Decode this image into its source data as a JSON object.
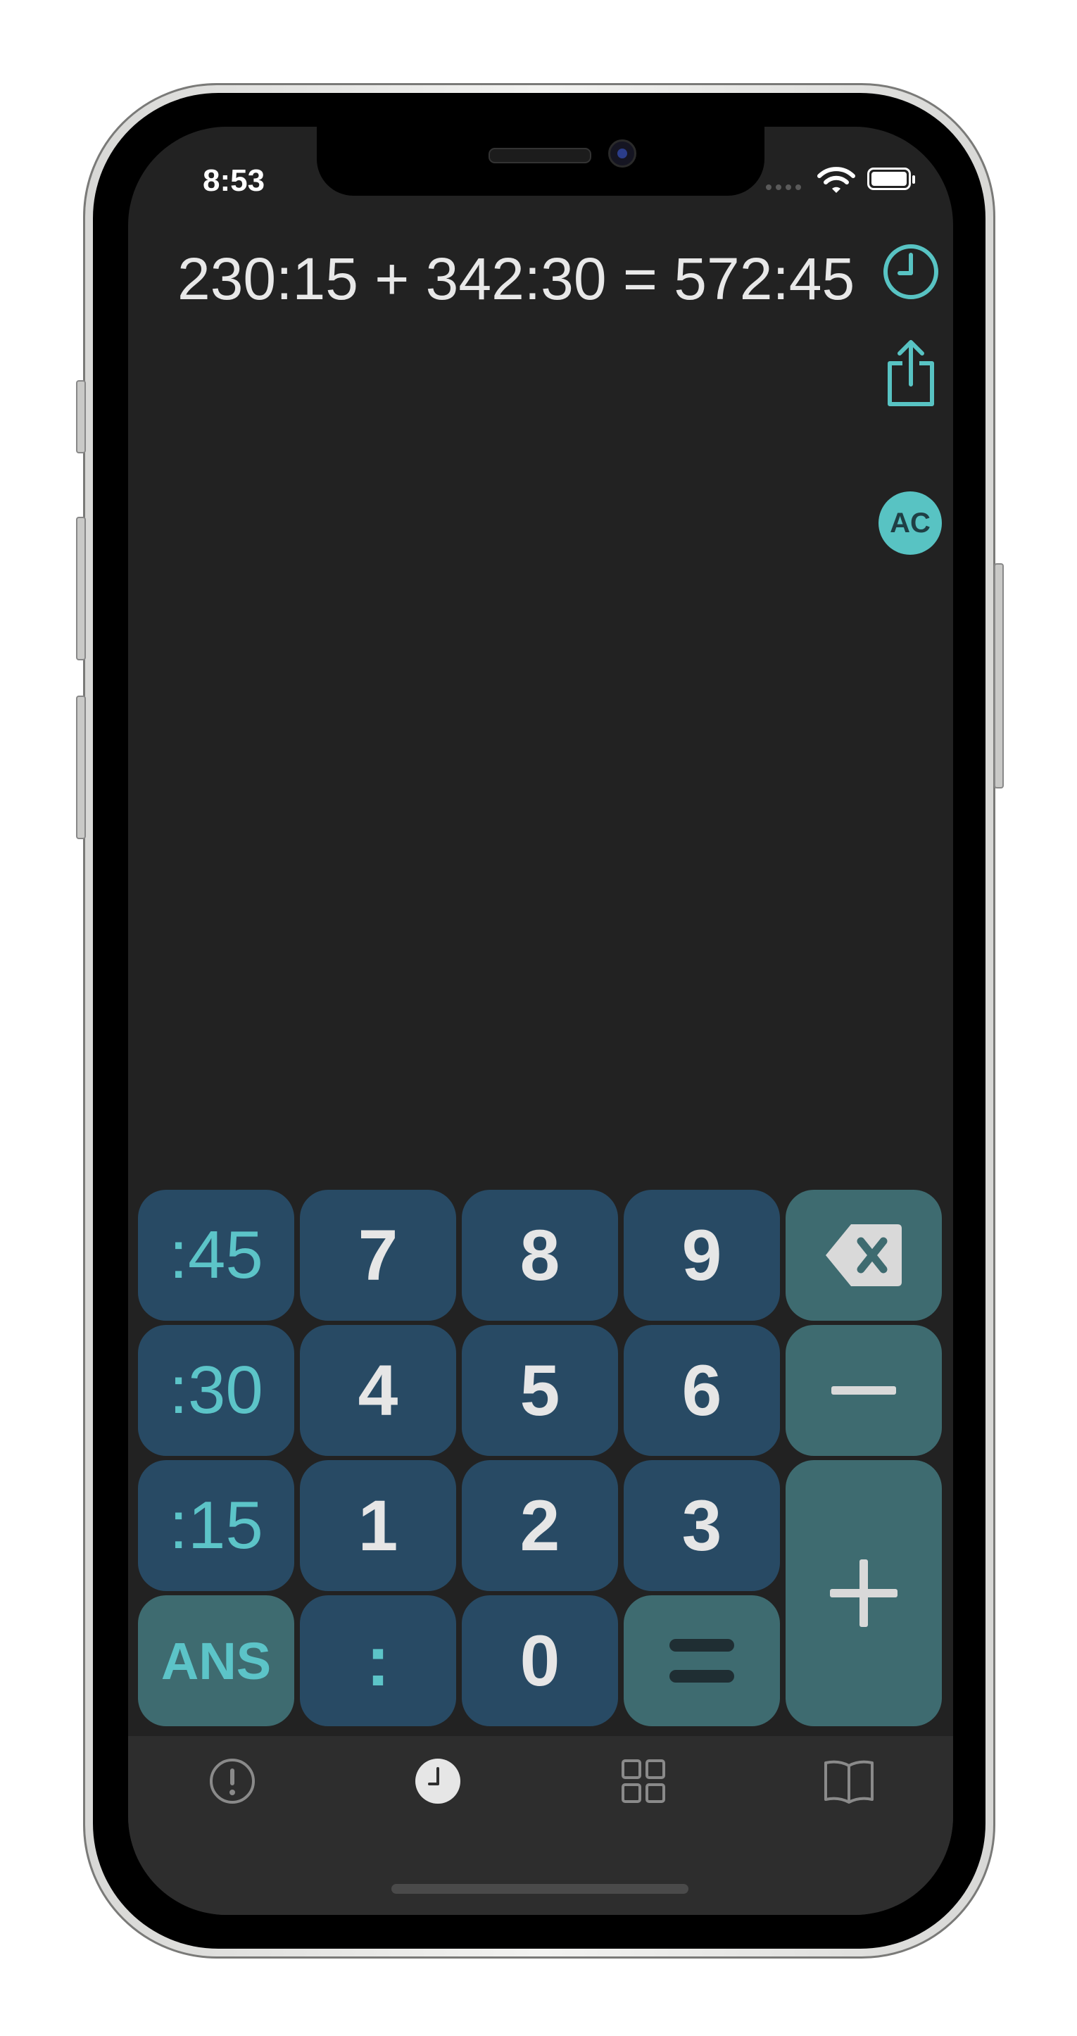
{
  "status_bar": {
    "time": "8:53"
  },
  "display": {
    "expression": "230:15 + 342:30 = 572:45"
  },
  "actions": {
    "history_icon": "clock-icon",
    "share_icon": "share-icon",
    "clear_label": "AC"
  },
  "keypad": {
    "quick_45": ":45",
    "quick_30": ":30",
    "quick_15": ":15",
    "ans": "ANS",
    "digits": {
      "d7": "7",
      "d8": "8",
      "d9": "9",
      "d4": "4",
      "d5": "5",
      "d6": "6",
      "d1": "1",
      "d2": "2",
      "d3": "3",
      "d0": "0"
    },
    "colon": ":",
    "minus_icon": "minus-icon",
    "plus_icon": "plus-icon",
    "equals_icon": "equals-icon",
    "backspace_icon": "backspace-icon"
  },
  "tab_bar": {
    "tabs": [
      {
        "icon": "info-icon",
        "selected": false
      },
      {
        "icon": "clock-icon",
        "selected": true
      },
      {
        "icon": "grid-icon",
        "selected": false
      },
      {
        "icon": "book-icon",
        "selected": false
      }
    ]
  },
  "colors": {
    "accent": "#58c3c3",
    "digit_key": "#284a64",
    "operator_key": "#3e6b70",
    "background": "#222222"
  }
}
